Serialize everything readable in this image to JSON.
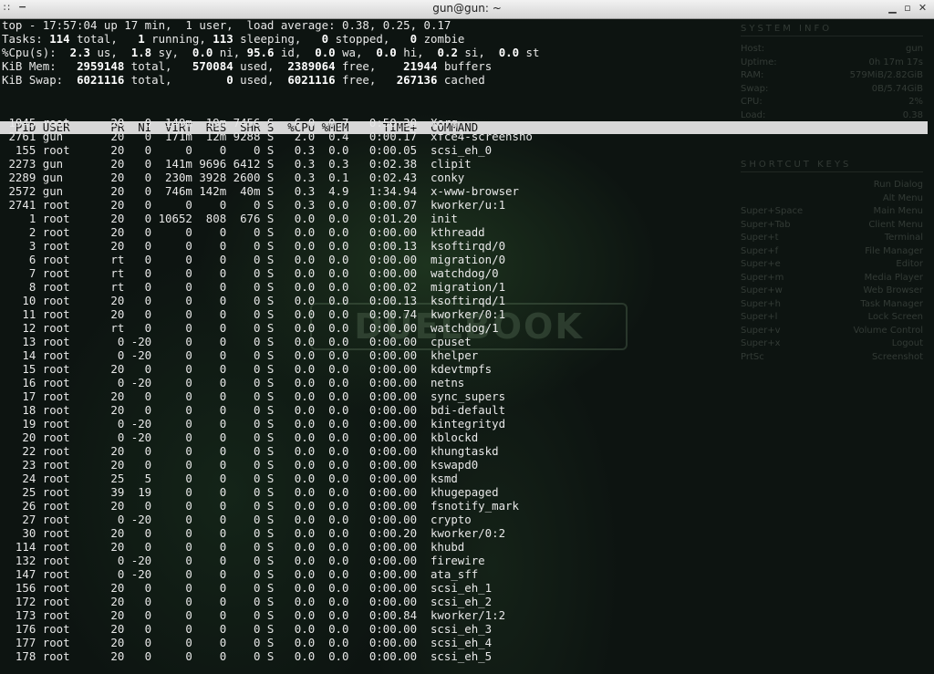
{
  "window": {
    "title": "gun@gun: ~",
    "menu_glyph": "∷",
    "pin_glyph": "−",
    "controls": [
      "▁",
      "▫",
      "✕"
    ]
  },
  "watermark": {
    "text": "DUELBOOK"
  },
  "conky": {
    "system_title": "SYSTEM INFO",
    "system": [
      {
        "k": "Host:",
        "v": "gun"
      },
      {
        "k": "Uptime:",
        "v": "0h 17m 17s"
      },
      {
        "k": "RAM:",
        "v": "579MiB/2.82GiB"
      },
      {
        "k": "Swap:",
        "v": "0B/5.74GiB"
      },
      {
        "k": "CPU:",
        "v": "2%"
      },
      {
        "k": "Load:",
        "v": "0.38"
      }
    ],
    "shortcut_title": "SHORTCUT KEYS",
    "shortcuts": [
      {
        "k": "",
        "v": "Run Dialog"
      },
      {
        "k": "",
        "v": "Alt Menu"
      },
      {
        "k": "Super+Space",
        "v": "Main Menu"
      },
      {
        "k": "Super+Tab",
        "v": "Client Menu"
      },
      {
        "k": "Super+t",
        "v": "Terminal"
      },
      {
        "k": "Super+f",
        "v": "File Manager"
      },
      {
        "k": "Super+e",
        "v": "Editor"
      },
      {
        "k": "Super+m",
        "v": "Media Player"
      },
      {
        "k": "Super+w",
        "v": "Web Browser"
      },
      {
        "k": "Super+h",
        "v": "Task Manager"
      },
      {
        "k": "Super+l",
        "v": "Lock Screen"
      },
      {
        "k": "Super+v",
        "v": "Volume Control"
      },
      {
        "k": "Super+x",
        "v": "Logout"
      },
      {
        "k": "PrtSc",
        "v": "Screenshot"
      }
    ]
  },
  "summary": [
    [
      {
        "t": "top - 17:57:04 up 17 min,  1 user,  load average: 0.38, 0.25, 0.17",
        "b": false
      }
    ],
    [
      {
        "t": "Tasks: ",
        "b": false
      },
      {
        "t": "114",
        "b": true
      },
      {
        "t": " total,   ",
        "b": false
      },
      {
        "t": "1",
        "b": true
      },
      {
        "t": " running, ",
        "b": false
      },
      {
        "t": "113",
        "b": true
      },
      {
        "t": " sleeping,   ",
        "b": false
      },
      {
        "t": "0",
        "b": true
      },
      {
        "t": " stopped,   ",
        "b": false
      },
      {
        "t": "0",
        "b": true
      },
      {
        "t": " zombie",
        "b": false
      }
    ],
    [
      {
        "t": "%Cpu(s):  ",
        "b": false
      },
      {
        "t": "2.3",
        "b": true
      },
      {
        "t": " us,  ",
        "b": false
      },
      {
        "t": "1.8",
        "b": true
      },
      {
        "t": " sy,  ",
        "b": false
      },
      {
        "t": "0.0",
        "b": true
      },
      {
        "t": " ni, ",
        "b": false
      },
      {
        "t": "95.6",
        "b": true
      },
      {
        "t": " id,  ",
        "b": false
      },
      {
        "t": "0.0",
        "b": true
      },
      {
        "t": " wa,  ",
        "b": false
      },
      {
        "t": "0.0",
        "b": true
      },
      {
        "t": " hi,  ",
        "b": false
      },
      {
        "t": "0.2",
        "b": true
      },
      {
        "t": " si,  ",
        "b": false
      },
      {
        "t": "0.0",
        "b": true
      },
      {
        "t": " st",
        "b": false
      }
    ],
    [
      {
        "t": "KiB Mem:   ",
        "b": false
      },
      {
        "t": "2959148",
        "b": true
      },
      {
        "t": " total,   ",
        "b": false
      },
      {
        "t": "570084",
        "b": true
      },
      {
        "t": " used,  ",
        "b": false
      },
      {
        "t": "2389064",
        "b": true
      },
      {
        "t": " free,    ",
        "b": false
      },
      {
        "t": "21944",
        "b": true
      },
      {
        "t": " buffers",
        "b": false
      }
    ],
    [
      {
        "t": "KiB Swap:  ",
        "b": false
      },
      {
        "t": "6021116",
        "b": true
      },
      {
        "t": " total,        ",
        "b": false
      },
      {
        "t": "0",
        "b": true
      },
      {
        "t": " used,  ",
        "b": false
      },
      {
        "t": "6021116",
        "b": true
      },
      {
        "t": " free,   ",
        "b": false
      },
      {
        "t": "267136",
        "b": true
      },
      {
        "t": " cached",
        "b": false
      }
    ]
  ],
  "header": "  PID USER      PR  NI  VIRT  RES  SHR S  %CPU %MEM     TIME+  COMMAND",
  "processes": [
    [
      "1945",
      "root",
      "20",
      "0",
      "149m",
      "19m",
      "7456",
      "S",
      "6.0",
      "0.7",
      "0:50.30",
      "Xorg"
    ],
    [
      "2761",
      "gun",
      "20",
      "0",
      "171m",
      "12m",
      "9288",
      "S",
      "2.0",
      "0.4",
      "0:00.17",
      "xfce4-screensho"
    ],
    [
      "155",
      "root",
      "20",
      "0",
      "0",
      "0",
      "0",
      "S",
      "0.3",
      "0.0",
      "0:00.05",
      "scsi_eh_0"
    ],
    [
      "2273",
      "gun",
      "20",
      "0",
      "141m",
      "9696",
      "6412",
      "S",
      "0.3",
      "0.3",
      "0:02.38",
      "clipit"
    ],
    [
      "2289",
      "gun",
      "20",
      "0",
      "230m",
      "3928",
      "2600",
      "S",
      "0.3",
      "0.1",
      "0:02.43",
      "conky"
    ],
    [
      "2572",
      "gun",
      "20",
      "0",
      "746m",
      "142m",
      "40m",
      "S",
      "0.3",
      "4.9",
      "1:34.94",
      "x-www-browser"
    ],
    [
      "2741",
      "root",
      "20",
      "0",
      "0",
      "0",
      "0",
      "S",
      "0.3",
      "0.0",
      "0:00.07",
      "kworker/u:1"
    ],
    [
      "1",
      "root",
      "20",
      "0",
      "10652",
      "808",
      "676",
      "S",
      "0.0",
      "0.0",
      "0:01.20",
      "init"
    ],
    [
      "2",
      "root",
      "20",
      "0",
      "0",
      "0",
      "0",
      "S",
      "0.0",
      "0.0",
      "0:00.00",
      "kthreadd"
    ],
    [
      "3",
      "root",
      "20",
      "0",
      "0",
      "0",
      "0",
      "S",
      "0.0",
      "0.0",
      "0:00.13",
      "ksoftirqd/0"
    ],
    [
      "6",
      "root",
      "rt",
      "0",
      "0",
      "0",
      "0",
      "S",
      "0.0",
      "0.0",
      "0:00.00",
      "migration/0"
    ],
    [
      "7",
      "root",
      "rt",
      "0",
      "0",
      "0",
      "0",
      "S",
      "0.0",
      "0.0",
      "0:00.00",
      "watchdog/0"
    ],
    [
      "8",
      "root",
      "rt",
      "0",
      "0",
      "0",
      "0",
      "S",
      "0.0",
      "0.0",
      "0:00.02",
      "migration/1"
    ],
    [
      "10",
      "root",
      "20",
      "0",
      "0",
      "0",
      "0",
      "S",
      "0.0",
      "0.0",
      "0:00.13",
      "ksoftirqd/1"
    ],
    [
      "11",
      "root",
      "20",
      "0",
      "0",
      "0",
      "0",
      "S",
      "0.0",
      "0.0",
      "0:00.74",
      "kworker/0:1"
    ],
    [
      "12",
      "root",
      "rt",
      "0",
      "0",
      "0",
      "0",
      "S",
      "0.0",
      "0.0",
      "0:00.00",
      "watchdog/1"
    ],
    [
      "13",
      "root",
      "0",
      "-20",
      "0",
      "0",
      "0",
      "S",
      "0.0",
      "0.0",
      "0:00.00",
      "cpuset"
    ],
    [
      "14",
      "root",
      "0",
      "-20",
      "0",
      "0",
      "0",
      "S",
      "0.0",
      "0.0",
      "0:00.00",
      "khelper"
    ],
    [
      "15",
      "root",
      "20",
      "0",
      "0",
      "0",
      "0",
      "S",
      "0.0",
      "0.0",
      "0:00.00",
      "kdevtmpfs"
    ],
    [
      "16",
      "root",
      "0",
      "-20",
      "0",
      "0",
      "0",
      "S",
      "0.0",
      "0.0",
      "0:00.00",
      "netns"
    ],
    [
      "17",
      "root",
      "20",
      "0",
      "0",
      "0",
      "0",
      "S",
      "0.0",
      "0.0",
      "0:00.00",
      "sync_supers"
    ],
    [
      "18",
      "root",
      "20",
      "0",
      "0",
      "0",
      "0",
      "S",
      "0.0",
      "0.0",
      "0:00.00",
      "bdi-default"
    ],
    [
      "19",
      "root",
      "0",
      "-20",
      "0",
      "0",
      "0",
      "S",
      "0.0",
      "0.0",
      "0:00.00",
      "kintegrityd"
    ],
    [
      "20",
      "root",
      "0",
      "-20",
      "0",
      "0",
      "0",
      "S",
      "0.0",
      "0.0",
      "0:00.00",
      "kblockd"
    ],
    [
      "22",
      "root",
      "20",
      "0",
      "0",
      "0",
      "0",
      "S",
      "0.0",
      "0.0",
      "0:00.00",
      "khungtaskd"
    ],
    [
      "23",
      "root",
      "20",
      "0",
      "0",
      "0",
      "0",
      "S",
      "0.0",
      "0.0",
      "0:00.00",
      "kswapd0"
    ],
    [
      "24",
      "root",
      "25",
      "5",
      "0",
      "0",
      "0",
      "S",
      "0.0",
      "0.0",
      "0:00.00",
      "ksmd"
    ],
    [
      "25",
      "root",
      "39",
      "19",
      "0",
      "0",
      "0",
      "S",
      "0.0",
      "0.0",
      "0:00.00",
      "khugepaged"
    ],
    [
      "26",
      "root",
      "20",
      "0",
      "0",
      "0",
      "0",
      "S",
      "0.0",
      "0.0",
      "0:00.00",
      "fsnotify_mark"
    ],
    [
      "27",
      "root",
      "0",
      "-20",
      "0",
      "0",
      "0",
      "S",
      "0.0",
      "0.0",
      "0:00.00",
      "crypto"
    ],
    [
      "30",
      "root",
      "20",
      "0",
      "0",
      "0",
      "0",
      "S",
      "0.0",
      "0.0",
      "0:00.20",
      "kworker/0:2"
    ],
    [
      "114",
      "root",
      "20",
      "0",
      "0",
      "0",
      "0",
      "S",
      "0.0",
      "0.0",
      "0:00.00",
      "khubd"
    ],
    [
      "132",
      "root",
      "0",
      "-20",
      "0",
      "0",
      "0",
      "S",
      "0.0",
      "0.0",
      "0:00.00",
      "firewire"
    ],
    [
      "147",
      "root",
      "0",
      "-20",
      "0",
      "0",
      "0",
      "S",
      "0.0",
      "0.0",
      "0:00.00",
      "ata_sff"
    ],
    [
      "156",
      "root",
      "20",
      "0",
      "0",
      "0",
      "0",
      "S",
      "0.0",
      "0.0",
      "0:00.00",
      "scsi_eh_1"
    ],
    [
      "172",
      "root",
      "20",
      "0",
      "0",
      "0",
      "0",
      "S",
      "0.0",
      "0.0",
      "0:00.00",
      "scsi_eh_2"
    ],
    [
      "173",
      "root",
      "20",
      "0",
      "0",
      "0",
      "0",
      "S",
      "0.0",
      "0.0",
      "0:00.84",
      "kworker/1:2"
    ],
    [
      "176",
      "root",
      "20",
      "0",
      "0",
      "0",
      "0",
      "S",
      "0.0",
      "0.0",
      "0:00.00",
      "scsi_eh_3"
    ],
    [
      "177",
      "root",
      "20",
      "0",
      "0",
      "0",
      "0",
      "S",
      "0.0",
      "0.0",
      "0:00.00",
      "scsi_eh_4"
    ],
    [
      "178",
      "root",
      "20",
      "0",
      "0",
      "0",
      "0",
      "S",
      "0.0",
      "0.0",
      "0:00.00",
      "scsi_eh_5"
    ]
  ]
}
